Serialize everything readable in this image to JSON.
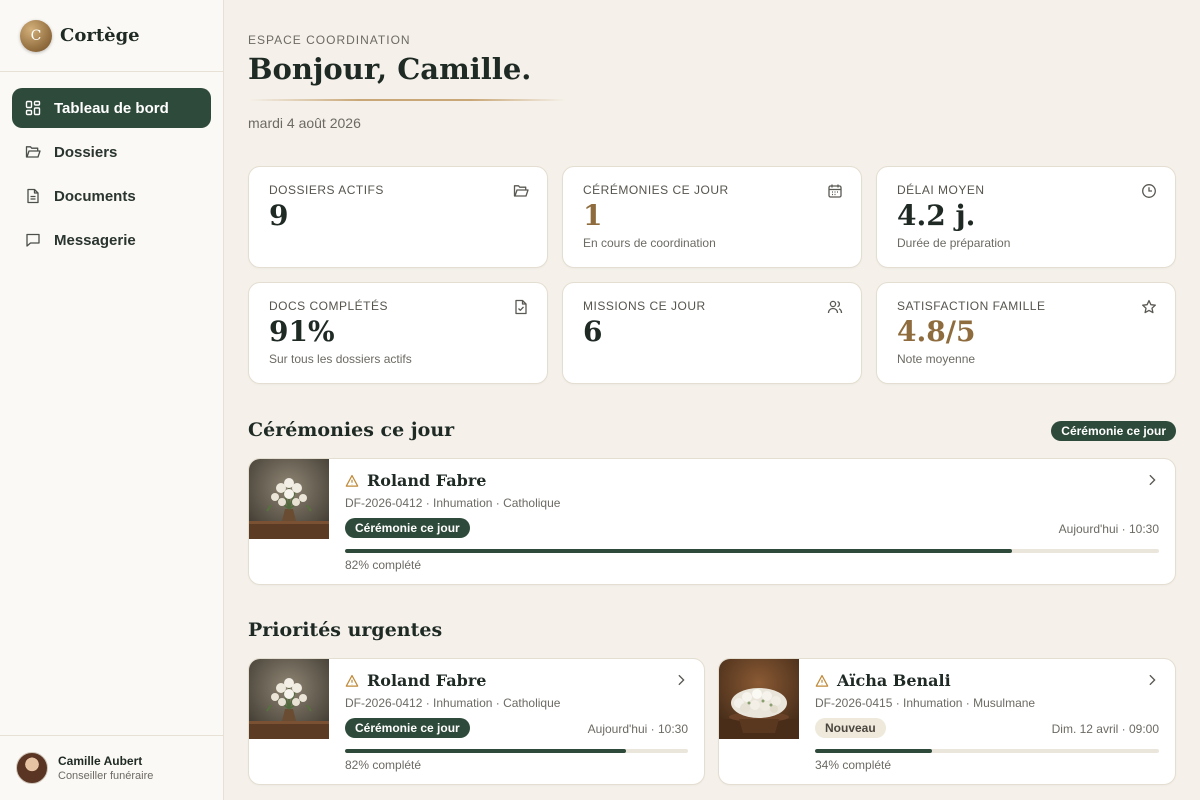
{
  "brand": {
    "logo_letter": "C",
    "name": "Cortège"
  },
  "nav": [
    {
      "label": "Tableau de bord",
      "icon": "dashboard-icon",
      "active": true
    },
    {
      "label": "Dossiers",
      "icon": "folder-icon",
      "active": false
    },
    {
      "label": "Documents",
      "icon": "document-icon",
      "active": false
    },
    {
      "label": "Messagerie",
      "icon": "message-icon",
      "active": false
    }
  ],
  "user": {
    "name": "Camille Aubert",
    "role": "Conseiller funéraire"
  },
  "header": {
    "eyebrow": "ESPACE COORDINATION",
    "greeting": "Bonjour, Camille.",
    "date": "mardi 4 août 2026"
  },
  "stats": [
    {
      "label": "DOSSIERS ACTIFS",
      "value": "9",
      "sub": "",
      "icon": "folder-icon"
    },
    {
      "label": "CÉRÉMONIES CE JOUR",
      "value": "1",
      "sub": "En cours de coordination",
      "icon": "calendar-icon"
    },
    {
      "label": "DÉLAI MOYEN",
      "value": "4.2 j.",
      "sub": "Durée de préparation",
      "icon": "clock-icon"
    },
    {
      "label": "DOCS COMPLÉTÉS",
      "value": "91%",
      "sub": "Sur tous les dossiers actifs",
      "icon": "file-check-icon"
    },
    {
      "label": "MISSIONS CE JOUR",
      "value": "6",
      "sub": "",
      "icon": "users-icon"
    },
    {
      "label": "SATISFACTION FAMILLE",
      "value": "4.8/5",
      "sub": "Note moyenne",
      "icon": "star-icon"
    }
  ],
  "ceremonies": {
    "title": "Cérémonies ce jour",
    "badge": "Cérémonie ce jour",
    "cards": [
      {
        "name": "Roland Fabre",
        "meta": "DF-2026-0412 · Inhumation · Catholique",
        "badge": "Cérémonie ce jour",
        "time": "Aujourd'hui · 10:30",
        "progress": 82,
        "progress_label": "82% complété"
      }
    ]
  },
  "priorities": {
    "title": "Priorités urgentes",
    "cards": [
      {
        "name": "Roland Fabre",
        "meta": "DF-2026-0412 · Inhumation · Catholique",
        "badge": "Cérémonie ce jour",
        "time": "Aujourd'hui · 10:30",
        "progress": 82,
        "progress_label": "82% complété"
      },
      {
        "name": "Aïcha Benali",
        "meta": "DF-2026-0415 · Inhumation · Musulmane",
        "badge": "Nouveau",
        "time": "Dim. 12 avril · 09:00",
        "progress": 34,
        "progress_label": "34% complété"
      }
    ]
  },
  "colors": {
    "primary": "#2e4a3a",
    "gold": "#8e6c3e",
    "background": "#f5f1ea",
    "warning": "#c08a3a"
  }
}
